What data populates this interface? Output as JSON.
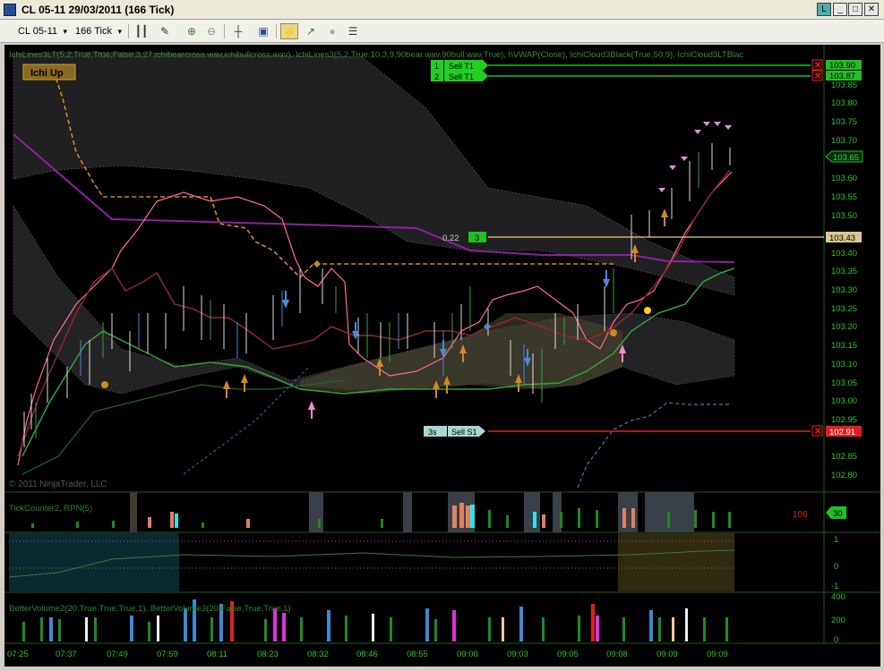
{
  "window": {
    "title": "CL 05-11  29/03/2011 (166 Tick)",
    "buttons": [
      "L",
      "_",
      "□",
      "✕"
    ]
  },
  "toolbar": {
    "instrument": "CL 05-11",
    "interval": "166 Tick"
  },
  "chart": {
    "indicator_line": "IchiLines3LT(5,2,True,True,False,3,27,ichibearcross.wav,ichibullcross.wav), IchiLines3(5,2,True,10,3,9,90bear.wav,90bull.wav,True), hVWAP(Close), IchiCloud3Black(True,50,9), IchiCloud3LTBlac",
    "badge": "Ichi Up",
    "copyright": "© 2011 NinjaTrader, LLC",
    "orders": [
      {
        "num": "1",
        "label": "Sell T1",
        "price": "103.90"
      },
      {
        "num": "2",
        "label": "Sell T1",
        "price": "103.87"
      }
    ],
    "stop_order": {
      "num": "3s",
      "label": "Sell S1",
      "price": "102.91"
    },
    "line_label": {
      "left": "0.22",
      "right": "3",
      "price": "103.43"
    },
    "last_price": "103.65",
    "price_ticks": [
      "103.85",
      "103.80",
      "103.75",
      "103.70",
      "103.60",
      "103.55",
      "103.50",
      "103.45",
      "103.40",
      "103.35",
      "103.30",
      "103.25",
      "103.20",
      "103.15",
      "103.10",
      "103.05",
      "103.00",
      "102.95",
      "102.85",
      "102.80"
    ],
    "time_ticks": [
      "07:25",
      "07:37",
      "07:49",
      "07:59",
      "08:11",
      "08:23",
      "08:32",
      "08:46",
      "08:55",
      "09:00",
      "09:03",
      "09:05",
      "09:08",
      "09:09",
      "09:09"
    ],
    "panel2": {
      "label": "TickCounter2, RPN(5)",
      "value": "106",
      "badge": "30"
    },
    "panel3": {
      "ticks": [
        "1",
        "0",
        "-1"
      ]
    },
    "panel4": {
      "label": "BetterVolume2(20,True,True,True,1), BetterVolume3(20,False,True,True,1)",
      "ticks": [
        "400",
        "200",
        "0"
      ]
    }
  }
}
